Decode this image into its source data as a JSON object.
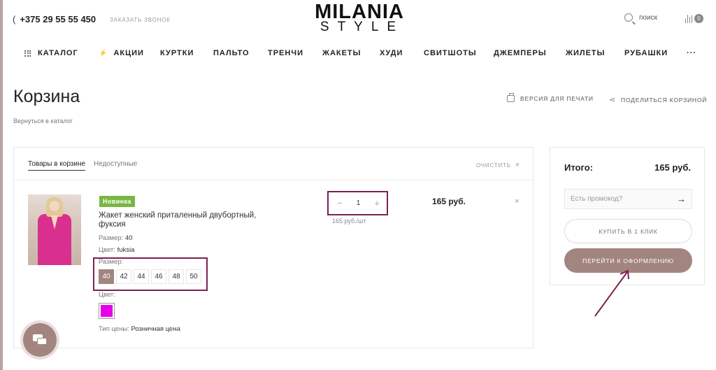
{
  "header": {
    "phone": "+375 29 55 55 450",
    "callback_label": "ЗАКАЗАТЬ ЗВОНОК",
    "logo_top": "MILANIA",
    "logo_bottom": "STYLE",
    "search_label": "поиск",
    "compare_count": "0"
  },
  "nav": {
    "items": [
      "КАТАЛОГ",
      "АКЦИИ",
      "КУРТКИ",
      "ПАЛЬТО",
      "ТРЕНЧИ",
      "ЖАКЕТЫ",
      "ХУДИ",
      "СВИТШОТЫ",
      "ДЖЕМПЕРЫ",
      "ЖИЛЕТЫ",
      "РУБАШКИ"
    ],
    "more": "···"
  },
  "page": {
    "title": "Корзина",
    "back_link": "Вернуться в каталог",
    "print_label": "ВЕРСИЯ ДЛЯ ПЕЧАТИ",
    "share_label": "ПОДЕЛИТЬСЯ КОРЗИНОЙ"
  },
  "cart": {
    "tabs": [
      "Товары в корзине",
      "Недоступные"
    ],
    "clear_label": "ОЧИСТИТЬ",
    "item": {
      "badge": "Новинка",
      "name": "Жакет женский приталенный двубортный, фуксия",
      "size_prop_label": "Размер:",
      "size_prop_value": "40",
      "color_prop_label": "Цвет:",
      "color_prop_value": "fuksia",
      "size_select_label": "Размер:",
      "sizes": [
        "40",
        "42",
        "44",
        "46",
        "48",
        "50"
      ],
      "selected_size": "40",
      "color_select_label": "Цвет:",
      "swatch_color": "#e800e8",
      "price_type_label": "Тип цены:",
      "price_type_value": "Розничная цена",
      "quantity": "1",
      "unit_price": "165 руб./шт",
      "line_price": "165 руб."
    }
  },
  "summary": {
    "total_label": "Итого:",
    "total_value": "165 руб.",
    "promo_placeholder": "Есть промокод?",
    "one_click_label": "КУПИТЬ В 1 КЛИК",
    "checkout_label": "ПЕРЕЙТИ К ОФОРМЛЕНИЮ"
  },
  "colors": {
    "accent": "#a38580",
    "annotation": "#7a2150",
    "new_badge": "#78b743"
  }
}
